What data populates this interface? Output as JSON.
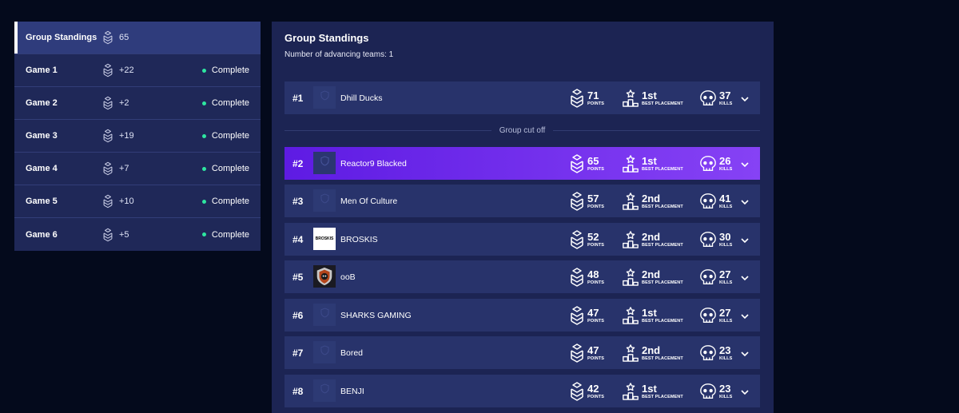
{
  "sidebar": {
    "items": [
      {
        "name": "Group Standings",
        "points": "65",
        "status": "",
        "active": true
      },
      {
        "name": "Game 1",
        "points": "+22",
        "status": "Complete"
      },
      {
        "name": "Game 2",
        "points": "+2",
        "status": "Complete"
      },
      {
        "name": "Game 3",
        "points": "+19",
        "status": "Complete"
      },
      {
        "name": "Game 4",
        "points": "+7",
        "status": "Complete"
      },
      {
        "name": "Game 5",
        "points": "+10",
        "status": "Complete"
      },
      {
        "name": "Game 6",
        "points": "+5",
        "status": "Complete"
      }
    ]
  },
  "panel": {
    "title": "Group Standings",
    "subtitle": "Number of advancing teams: 1",
    "cutoff_label": "Group cut off"
  },
  "labels": {
    "points": "POINTS",
    "best_placement": "BEST PLACEMENT",
    "kills": "KILLS"
  },
  "standings": [
    {
      "rank": "#1",
      "team": "Dhill Ducks",
      "points": "71",
      "placement": "1st",
      "kills": "37",
      "logo": "placeholder"
    },
    {
      "rank": "#2",
      "team": "Reactor9 Blacked",
      "points": "65",
      "placement": "1st",
      "kills": "26",
      "logo": "placeholder",
      "highlight": true
    },
    {
      "rank": "#3",
      "team": "Men Of Culture",
      "points": "57",
      "placement": "2nd",
      "kills": "41",
      "logo": "placeholder"
    },
    {
      "rank": "#4",
      "team": "BROSKIS",
      "points": "52",
      "placement": "2nd",
      "kills": "30",
      "logo": "broskis",
      "logo_text": "BROSKIS"
    },
    {
      "rank": "#5",
      "team": "ooB",
      "points": "48",
      "placement": "2nd",
      "kills": "27",
      "logo": "oob"
    },
    {
      "rank": "#6",
      "team": "SHARKS GAMING",
      "points": "47",
      "placement": "1st",
      "kills": "27",
      "logo": "placeholder"
    },
    {
      "rank": "#7",
      "team": "Bored",
      "points": "47",
      "placement": "2nd",
      "kills": "23",
      "logo": "placeholder"
    },
    {
      "rank": "#8",
      "team": "BENJI",
      "points": "42",
      "placement": "1st",
      "kills": "23",
      "logo": "placeholder"
    }
  ],
  "colors": {
    "background": "#040a1c",
    "panel": "#1c2453",
    "row": "#28336b",
    "highlight_start": "#5e1be3",
    "highlight_end": "#8642f5",
    "status_dot": "#2ee6a0"
  },
  "icons": {
    "points": "chevron-rank-icon",
    "placement": "podium-icon",
    "kills": "skull-icon",
    "expand": "chevron-down-icon",
    "logo_placeholder": "shield-icon"
  }
}
